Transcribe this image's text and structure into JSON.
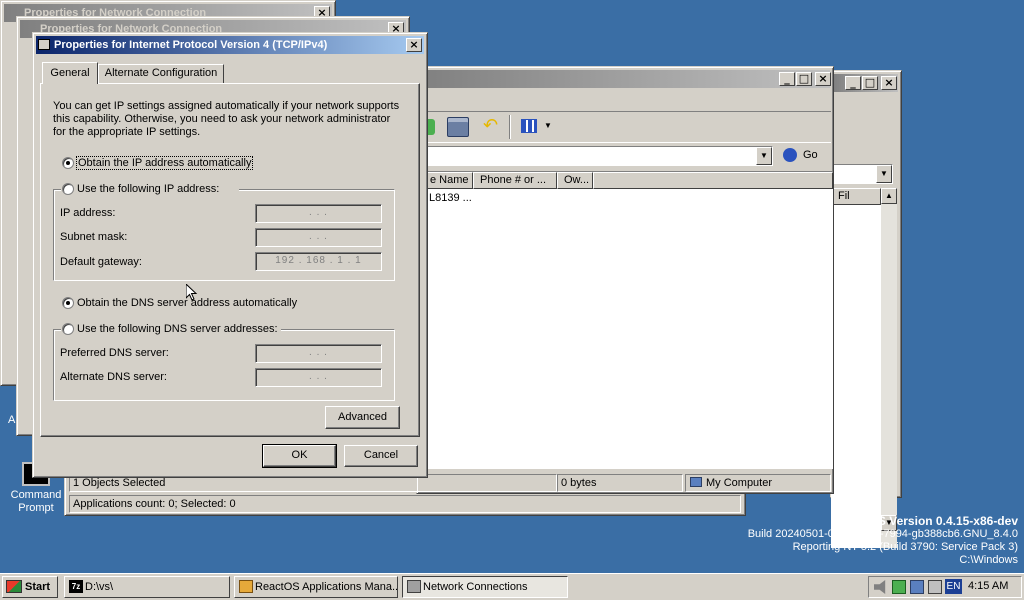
{
  "desktop": {
    "icon_label": "Command Prompt",
    "stray_letter": "A",
    "version": {
      "title": "ReactOS Version 0.4.15-x86-dev",
      "build": "Build 20240501-0.4.15-dev-7994-gb388cb6.GNU_8.4.0",
      "reporting": "Reporting NT 5.2 (Build 3790: Service Pack 3)",
      "path": "C:\\Windows"
    }
  },
  "bg_windows": {
    "title1": "Properties for Network Connection",
    "title2": "Properties for Network Connection"
  },
  "explorer": {
    "columns": [
      "e Name",
      "Phone # or ...",
      "Ow..."
    ],
    "row_text": "L8139 ...",
    "go_label": "Go",
    "right_col": "Fil",
    "status_objects": "1 Objects Selected",
    "status_size": "0 bytes",
    "status_location": "My Computer",
    "apps_status": "Applications count: 0; Selected: 0"
  },
  "dialog": {
    "title": "Properties for Internet Protocol Version 4 (TCP/IPv4)",
    "tabs": [
      "General",
      "Alternate Configuration"
    ],
    "description": "You can get IP settings assigned automatically if your network supports this capability. Otherwise, you need to ask your network administrator for the appropriate IP settings.",
    "radio_auto_ip": "Obtain the IP address automatically",
    "radio_manual_ip": "Use the following IP address:",
    "ip_address_label": "IP address:",
    "subnet_label": "Subnet mask:",
    "gateway_label": "Default gateway:",
    "ip_value": ". . .",
    "subnet_value": ". . .",
    "gateway_value": "192 . 168 . 1 . 1",
    "radio_auto_dns": "Obtain the DNS server address automatically",
    "radio_manual_dns": "Use the following DNS server addresses:",
    "preferred_dns_label": "Preferred DNS server:",
    "alternate_dns_label": "Alternate DNS server:",
    "preferred_dns_value": ". . .",
    "alternate_dns_value": ". . .",
    "advanced": "Advanced",
    "ok": "OK",
    "cancel": "Cancel"
  },
  "taskbar": {
    "start": "Start",
    "items": [
      "D:\\vs\\",
      "ReactOS Applications Mana...",
      "Network Connections"
    ],
    "lang": "EN",
    "clock": "4:15 AM"
  },
  "colors": {
    "desktop": "#3a6ea5",
    "face": "#d4d0c8",
    "active_title": "#0a246a"
  }
}
